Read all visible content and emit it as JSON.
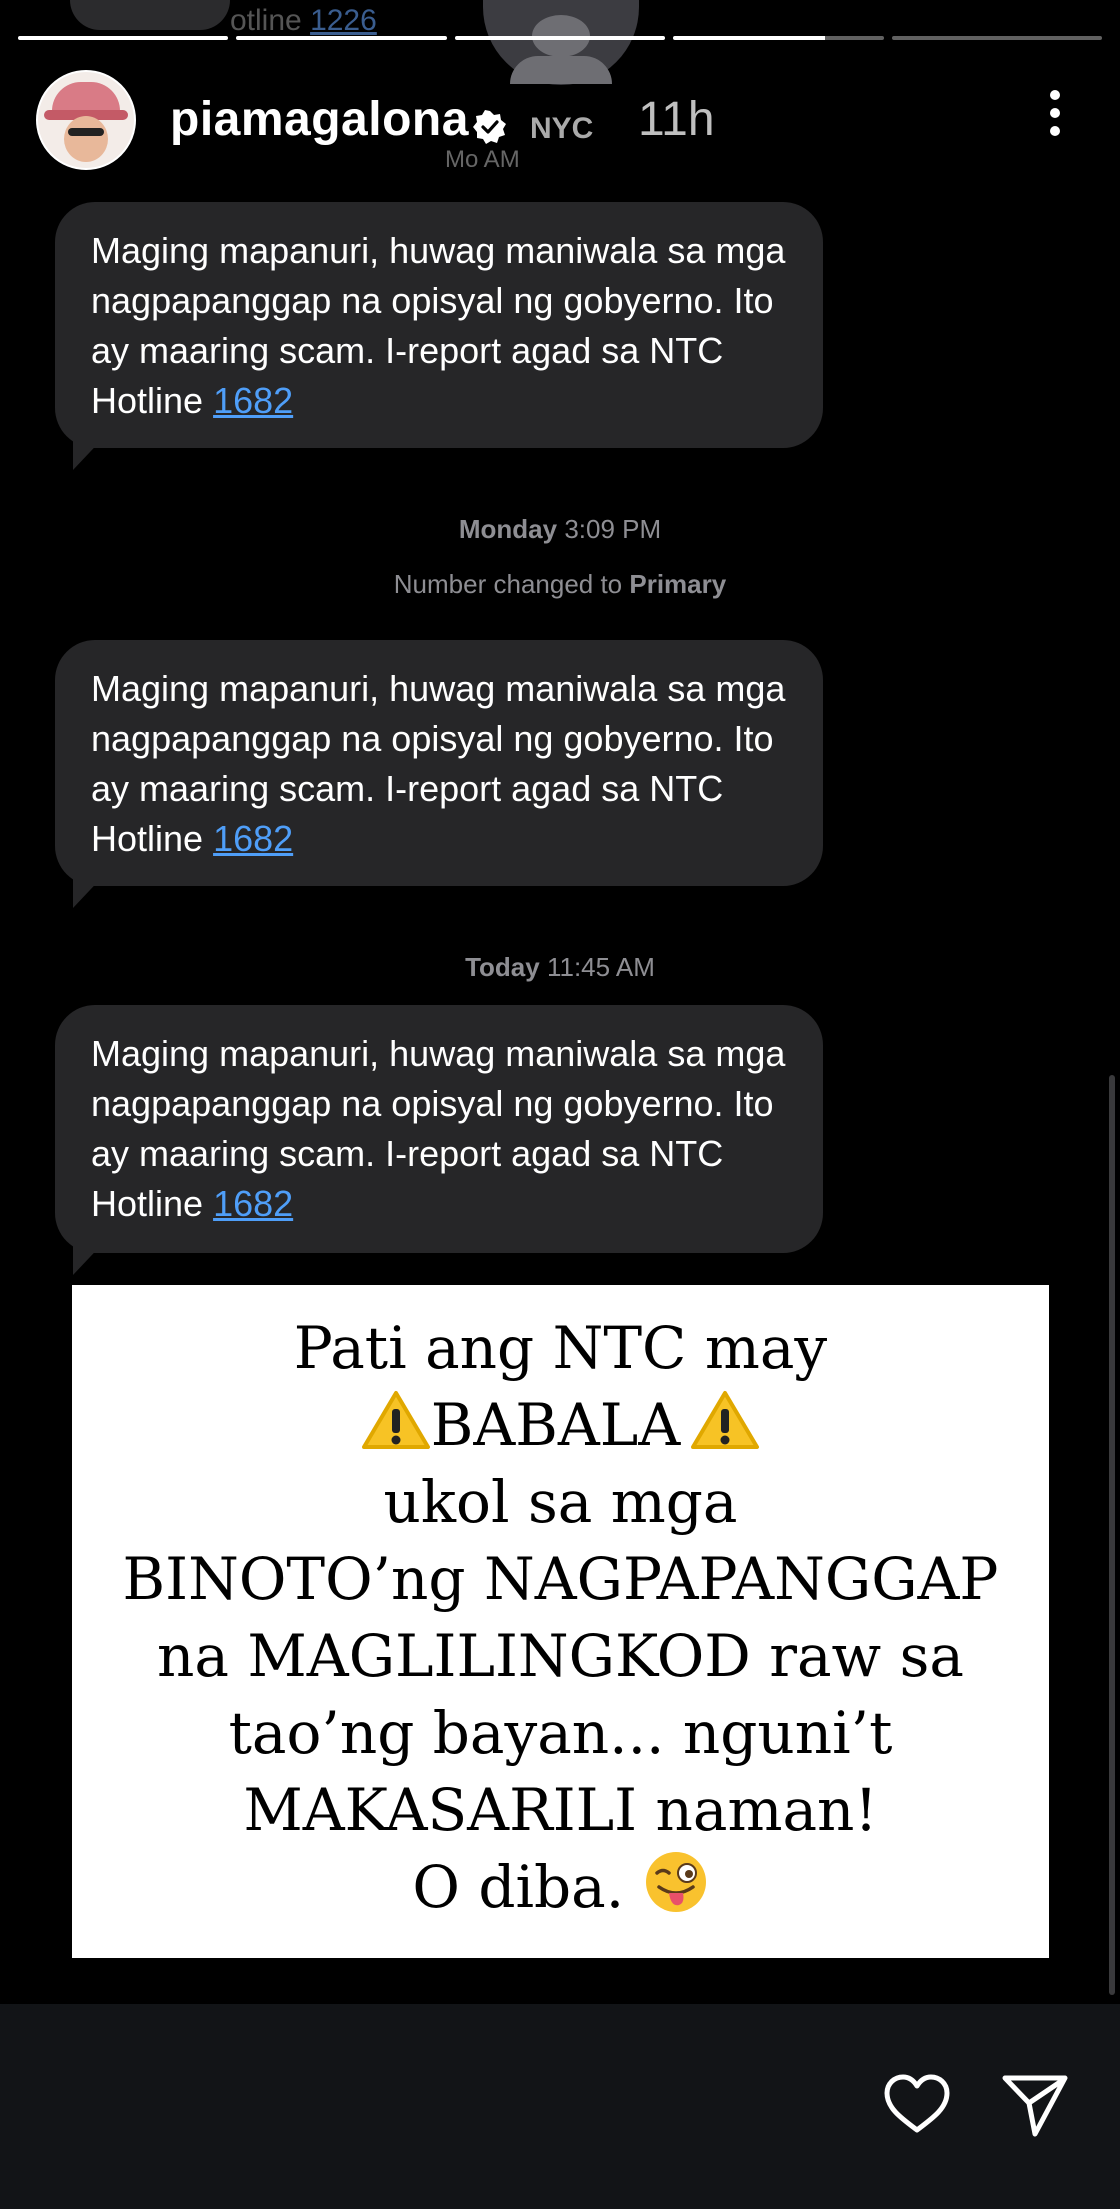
{
  "story": {
    "username": "piamagalona",
    "time_ago": "11h",
    "progress_segments": [
      1,
      1,
      1,
      0.72,
      0
    ],
    "background_ghost": {
      "ghost_text_prefix": "otline ",
      "ghost_text_link": "1226",
      "sender_name": "NYC",
      "timestamp_partial": "Mo        AM"
    }
  },
  "messages": [
    {
      "timestamp_day": "",
      "timestamp_time": "",
      "text": "Maging mapanuri, huwag maniwala sa mga nagpapanggap na opisyal ng gobyerno. Ito ay maaring scam. I-report agad sa NTC Hotline ",
      "link": "1682"
    },
    {
      "timestamp_day": "Monday",
      "timestamp_time": "3:09 PM",
      "status_prefix": "Number changed to ",
      "status_value": "Primary",
      "text": "Maging mapanuri, huwag maniwala sa mga nagpapanggap na opisyal ng gobyerno. Ito ay maaring scam. I-report agad sa NTC Hotline ",
      "link": "1682"
    },
    {
      "timestamp_day": "Today",
      "timestamp_time": "11:45 AM",
      "text": "Maging mapanuri, huwag maniwala sa mga nagpapanggap na opisyal ng gobyerno. Ito ay maaring scam. I-report agad sa NTC Hotline ",
      "link": "1682"
    }
  ],
  "card": {
    "line1": "Pati ang NTC may",
    "line2": "BABALA",
    "line3": "ukol sa mga",
    "line4": "BINOTO’ng NAGPAPANGGAP",
    "line5": "na MAGLILINGKOD raw sa",
    "line6": "tao’ng bayan... nguni’t",
    "line7": "MAKASARILI naman!",
    "line8": "O diba."
  },
  "icons": {
    "warning": "warning-emoji",
    "wink": "winking-face-with-tongue-emoji",
    "like": "heart-icon",
    "share": "send-icon",
    "more": "more-vertical-icon",
    "verified": "verified-badge-icon"
  },
  "colors": {
    "bubble": "#262628",
    "link": "#4f9ef8",
    "bottom_bar": "#121417"
  }
}
